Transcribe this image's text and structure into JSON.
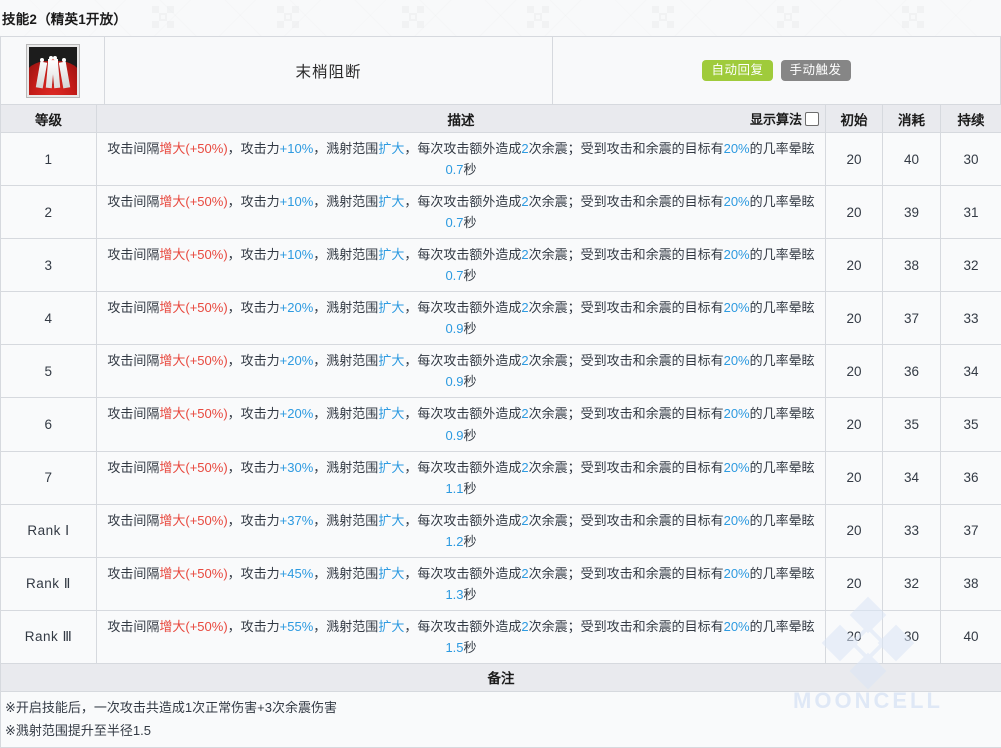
{
  "header": {
    "title": "技能2（精英1开放）"
  },
  "skill": {
    "icon_name": "skill-icon-terminal-block",
    "name": "末梢阻断",
    "tags": [
      {
        "label": "自动回复",
        "color": "#9fcb3b",
        "name": "tag-auto-recovery"
      },
      {
        "label": "手动触发",
        "color": "#868686",
        "name": "tag-manual-trigger"
      }
    ]
  },
  "table": {
    "columns": {
      "level": "等级",
      "description": "描述",
      "show_algorithm": "显示算法",
      "initial": "初始",
      "cost": "消耗",
      "duration": "持续"
    },
    "show_algorithm_checked": false,
    "rows": [
      {
        "level": "1",
        "atk": "+10%",
        "stun": "0.7",
        "initial": "20",
        "cost": "40",
        "duration": "30"
      },
      {
        "level": "2",
        "atk": "+10%",
        "stun": "0.7",
        "initial": "20",
        "cost": "39",
        "duration": "31"
      },
      {
        "level": "3",
        "atk": "+10%",
        "stun": "0.7",
        "initial": "20",
        "cost": "38",
        "duration": "32"
      },
      {
        "level": "4",
        "atk": "+20%",
        "stun": "0.9",
        "initial": "20",
        "cost": "37",
        "duration": "33"
      },
      {
        "level": "5",
        "atk": "+20%",
        "stun": "0.9",
        "initial": "20",
        "cost": "36",
        "duration": "34"
      },
      {
        "level": "6",
        "atk": "+20%",
        "stun": "0.9",
        "initial": "20",
        "cost": "35",
        "duration": "35"
      },
      {
        "level": "7",
        "atk": "+30%",
        "stun": "1.1",
        "initial": "20",
        "cost": "34",
        "duration": "36"
      },
      {
        "level": "Rank Ⅰ",
        "atk": "+37%",
        "stun": "1.2",
        "initial": "20",
        "cost": "33",
        "duration": "37"
      },
      {
        "level": "Rank Ⅱ",
        "atk": "+45%",
        "stun": "1.3",
        "initial": "20",
        "cost": "32",
        "duration": "38"
      },
      {
        "level": "Rank Ⅲ",
        "atk": "+55%",
        "stun": "1.5",
        "initial": "20",
        "cost": "30",
        "duration": "40"
      }
    ],
    "description_template": {
      "seg1": "攻击间隔",
      "seg2_red": "增大(+50%)",
      "seg3": "，攻击力",
      "seg5": "，溅射范围",
      "seg6_blue": "扩大",
      "seg7": "，每次攻击额外造成",
      "seg8_blue": "2",
      "seg9": "次余震；受到攻击和余震的目标有",
      "seg10_blue": "20%",
      "seg11": "的几率晕眩",
      "seg13": "秒"
    }
  },
  "notes": {
    "title": "备注",
    "lines": [
      "※开启技能后，一次攻击共造成1次正常伤害+3次余震伤害",
      "※溅射范围提升至半径1.5"
    ]
  },
  "watermark": {
    "text": "MOONCELL"
  }
}
